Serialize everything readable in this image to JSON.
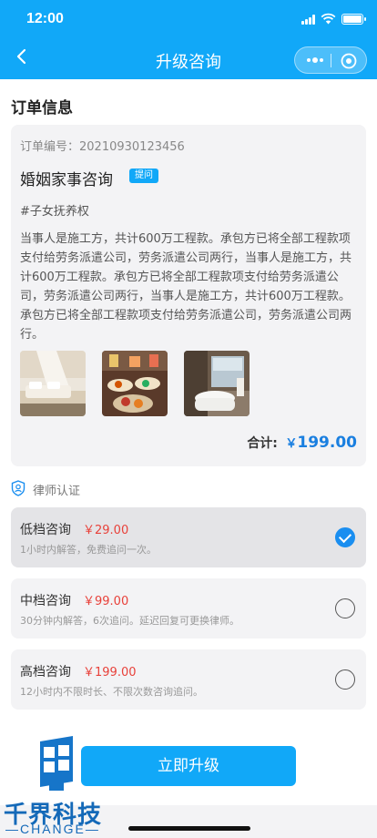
{
  "status_bar": {
    "time": "12:00"
  },
  "nav": {
    "title": "升级咨询",
    "back_icon": "chevron-left-icon",
    "more_icon": "more-dots-icon",
    "close_icon": "target-circle-icon"
  },
  "order": {
    "section_title": "订单信息",
    "order_number": "订单编号：20210930123456",
    "case_title": "婚姻家事咨询",
    "badge": "提问",
    "tag": "#子女抚养权",
    "description": "当事人是施工方，共计600万工程款。承包方已将全部工程款项支付给劳务派遣公司，劳务派遣公司两行，当事人是施工方，共计600万工程款。承包方已将全部工程款项支付给劳务派遣公司，劳务派遣公司两行，当事人是施工方，共计600万工程款。承包方已将全部工程款项支付给劳务派遣公司，劳务派遣公司两行。",
    "photos": [
      "bedroom-photo",
      "buffet-photo",
      "bathroom-photo"
    ],
    "total_label": "合计:",
    "total_currency": "￥",
    "total_amount": "199.00"
  },
  "lawyer_auth": {
    "label": "律师认证",
    "icon": "shield-icon"
  },
  "plans": [
    {
      "name": "低档咨询",
      "price": "￥29.00",
      "desc": "1小时内解答，免费追问一次。",
      "selected": true
    },
    {
      "name": "中档咨询",
      "price": "￥99.00",
      "desc": "30分钟内解答，6次追问。延迟回复可更换律师。",
      "selected": false
    },
    {
      "name": "高档咨询",
      "price": "￥199.00",
      "desc": "12小时内不限时长、不限次数咨询追问。",
      "selected": false
    }
  ],
  "upgrade_button": "立即升级",
  "watermark": {
    "cn": "千界科技",
    "en": "—CHANGE—"
  },
  "colors": {
    "primary": "#11a8f8",
    "price_red": "#e8413a",
    "total_blue": "#1a7fe0",
    "card_bg": "#f3f3f5"
  }
}
